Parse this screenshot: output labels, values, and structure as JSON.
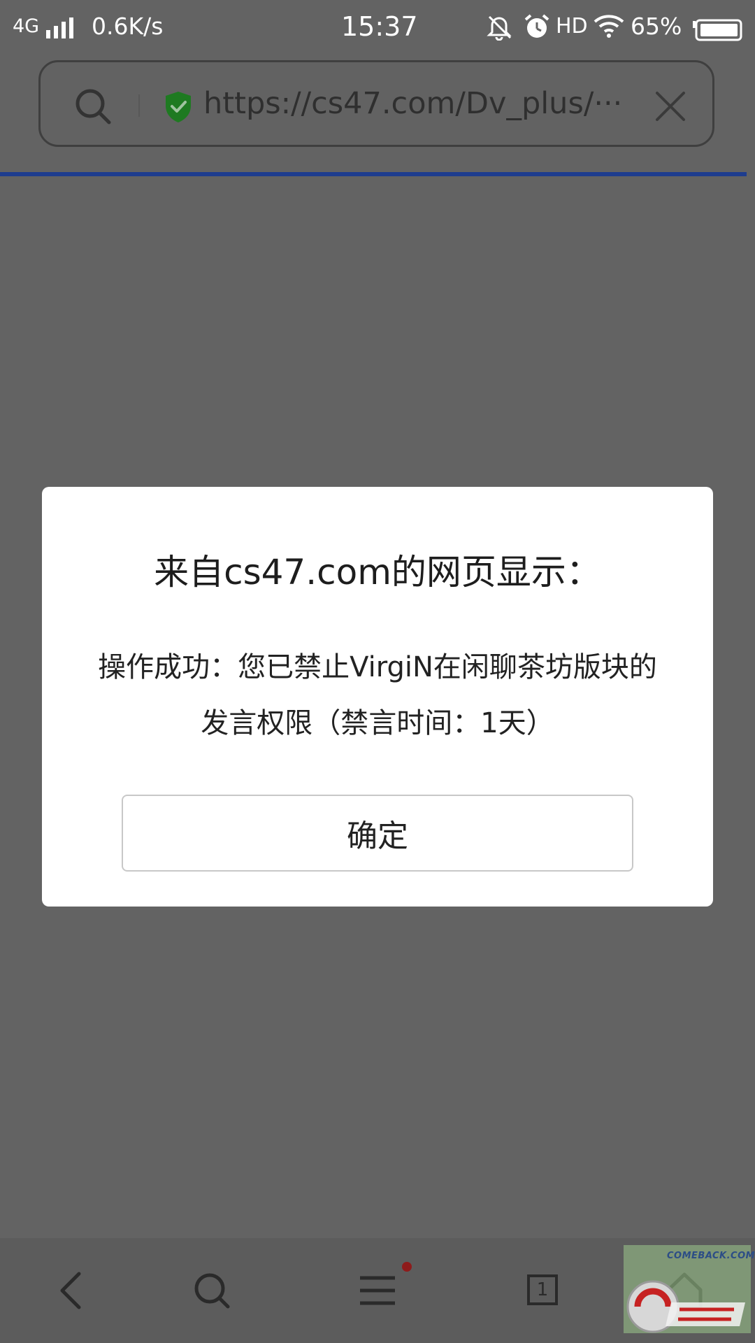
{
  "status_bar": {
    "network": "4G",
    "speed": "0.6K/s",
    "time": "15:37",
    "hd_label": "HD",
    "battery": "65%"
  },
  "address_bar": {
    "url": "https://cs47.com/Dv_plus/···",
    "icons": [
      "search-icon",
      "secure-shield-icon",
      "close-icon"
    ]
  },
  "dialog": {
    "title": "来自cs47.com的网页显示：",
    "message_line1": "操作成功：您已禁止VirgiN在闲聊茶坊版块的",
    "message_line2": "发言权限（禁言时间：1天）",
    "ok_label": "确定"
  },
  "bottom_bar": {
    "tab_count": "1",
    "icons": [
      "back-icon",
      "search-icon",
      "menu-icon",
      "tabs-icon",
      "home-icon"
    ]
  },
  "watermark": {
    "text": "COMEBACK.COM"
  },
  "colors": {
    "overlay": "#636363",
    "dialog_bg": "#ffffff",
    "progress": "#1e3d8e",
    "secure_shield": "#1e7a21",
    "notification_dot": "#8e1b1b"
  }
}
